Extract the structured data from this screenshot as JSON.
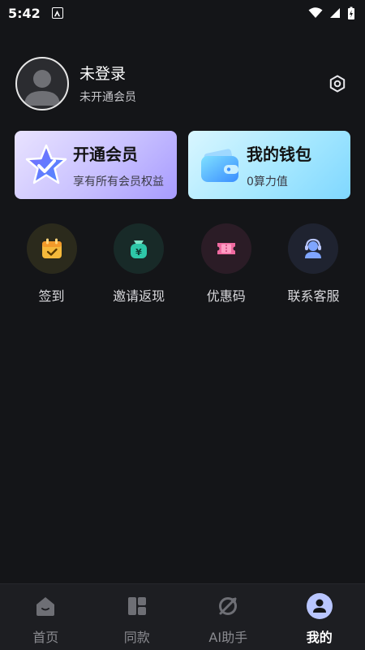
{
  "status_bar": {
    "time": "5:42"
  },
  "profile": {
    "name": "未登录",
    "subtitle": "未开通会员"
  },
  "cards": {
    "vip": {
      "title": "开通会员",
      "subtitle": "享有所有会员权益"
    },
    "wallet": {
      "title": "我的钱包",
      "subtitle": "0算力值"
    }
  },
  "actions": [
    {
      "label": "签到",
      "icon": "calendar-check-icon",
      "color": "#f5b93b"
    },
    {
      "label": "邀请返现",
      "icon": "money-bag-icon",
      "color": "#2ec7a8"
    },
    {
      "label": "优惠码",
      "icon": "coupon-icon",
      "color": "#f06aa0"
    },
    {
      "label": "联系客服",
      "icon": "headset-icon",
      "color": "#7fa5ff"
    }
  ],
  "nav": [
    {
      "label": "首页",
      "icon": "home-icon",
      "active": false
    },
    {
      "label": "同款",
      "icon": "layout-icon",
      "active": false
    },
    {
      "label": "AI助手",
      "icon": "ai-assistant-icon",
      "active": false
    },
    {
      "label": "我的",
      "icon": "profile-icon",
      "active": true
    }
  ],
  "colors": {
    "background": "#141518",
    "nav_background": "#1d1e22",
    "active_accent": "#b9c6ff"
  }
}
